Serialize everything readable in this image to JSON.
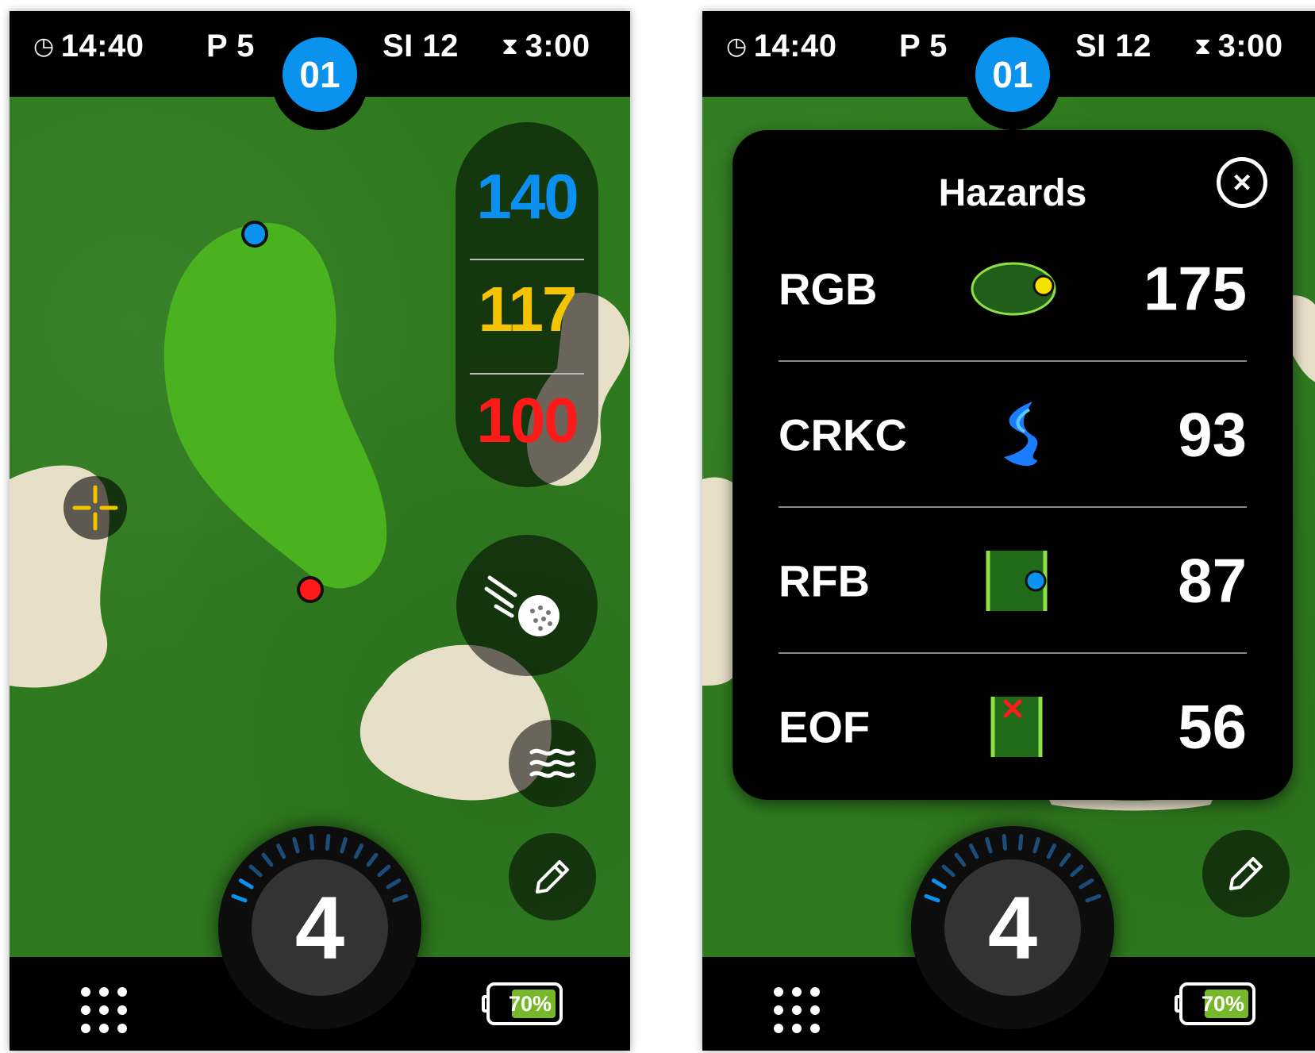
{
  "left_screen": {
    "topbar": {
      "time": "14:40",
      "par": "P 5",
      "hole": "01",
      "stroke_index": "SI 12",
      "timer": "3:00"
    },
    "distances": {
      "front": "140",
      "middle": "117",
      "back": "100"
    },
    "club": "4",
    "battery": "70%",
    "battery_level": 0.7,
    "buttons": [
      "shot-track",
      "hazards",
      "scorecard-edit"
    ]
  },
  "right_screen": {
    "topbar": {
      "time": "14:40",
      "par": "P 5",
      "hole": "01",
      "stroke_index": "SI 12",
      "timer": "3:00"
    },
    "hazards_panel": {
      "title": "Hazards",
      "rows": [
        {
          "code": "RGB",
          "distance": "175",
          "icon": "green-bunker-icon"
        },
        {
          "code": "CRKC",
          "distance": "93",
          "icon": "creek-icon"
        },
        {
          "code": "RFB",
          "distance": "87",
          "icon": "fairway-bunker-icon"
        },
        {
          "code": "EOF",
          "distance": "56",
          "icon": "end-of-fairway-icon"
        }
      ]
    },
    "club": "4",
    "battery": "70%",
    "battery_level": 0.7
  },
  "colors": {
    "accent_blue": "#0a93ee",
    "front_distance": "#0b8ff0",
    "middle_distance": "#f5c400",
    "back_distance": "#ff1a1a",
    "fairway": "#2f7a1f",
    "green": "#49b21e",
    "sand": "#e8dfc9",
    "battery_fill": "#76b82a"
  }
}
